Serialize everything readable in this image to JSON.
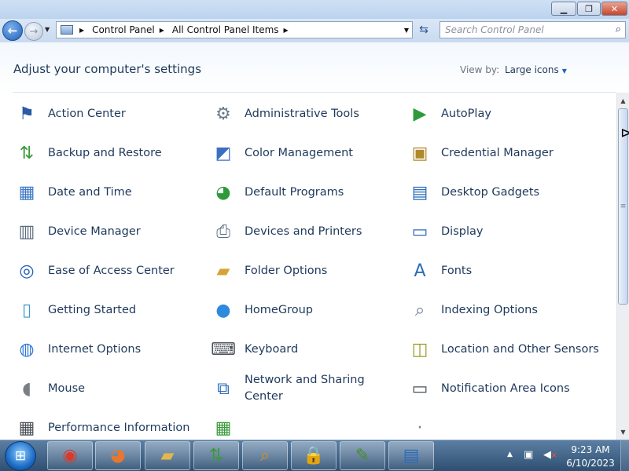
{
  "window": {
    "minimize": "▁",
    "maximize": "❐",
    "close": "✕"
  },
  "address": {
    "crumbs": [
      "Control Panel",
      "All Control Panel Items"
    ],
    "separator": "▶",
    "search_placeholder": "Search Control Panel"
  },
  "header": {
    "title": "Adjust your computer's settings",
    "view_by_label": "View by:",
    "view_by_value": "Large icons"
  },
  "items": [
    {
      "label": "Action Center",
      "icon": "flag-icon",
      "glyph": "⚑",
      "color": "#2a5aa8"
    },
    {
      "label": "Administrative Tools",
      "icon": "admin-tools-icon",
      "glyph": "⚙",
      "color": "#6a7a8c"
    },
    {
      "label": "AutoPlay",
      "icon": "autoplay-icon",
      "glyph": "▶",
      "color": "#2e9a3a"
    },
    {
      "label": "Backup and Restore",
      "icon": "backup-icon",
      "glyph": "⇅",
      "color": "#3a9a3a"
    },
    {
      "label": "Color Management",
      "icon": "color-management-icon",
      "glyph": "◩",
      "color": "#3c6fc4"
    },
    {
      "label": "Credential Manager",
      "icon": "credential-manager-icon",
      "glyph": "▣",
      "color": "#b08a2a"
    },
    {
      "label": "Date and Time",
      "icon": "calendar-clock-icon",
      "glyph": "▦",
      "color": "#3b78c7"
    },
    {
      "label": "Default Programs",
      "icon": "default-programs-icon",
      "glyph": "◕",
      "color": "#2e9a3a"
    },
    {
      "label": "Desktop Gadgets",
      "icon": "desktop-gadgets-icon",
      "glyph": "▤",
      "color": "#2b6cb8"
    },
    {
      "label": "Device Manager",
      "icon": "device-manager-icon",
      "glyph": "▥",
      "color": "#5b6b80"
    },
    {
      "label": "Devices and Printers",
      "icon": "printer-icon",
      "glyph": "⎙",
      "color": "#5b6b80"
    },
    {
      "label": "Display",
      "icon": "monitor-icon",
      "glyph": "▭",
      "color": "#2b6cb8"
    },
    {
      "label": "Ease of Access Center",
      "icon": "ease-of-access-icon",
      "glyph": "◎",
      "color": "#1f5fb8"
    },
    {
      "label": "Folder Options",
      "icon": "folder-options-icon",
      "glyph": "▰",
      "color": "#d4a534"
    },
    {
      "label": "Fonts",
      "icon": "fonts-icon",
      "glyph": "A",
      "color": "#2b6cb8"
    },
    {
      "label": "Getting Started",
      "icon": "getting-started-icon",
      "glyph": "▯",
      "color": "#3a9ad0"
    },
    {
      "label": "HomeGroup",
      "icon": "homegroup-icon",
      "glyph": "●",
      "color": "#2e8adc"
    },
    {
      "label": "Indexing Options",
      "icon": "indexing-icon",
      "glyph": "⌕",
      "color": "#6a7a8c"
    },
    {
      "label": "Internet Options",
      "icon": "internet-options-icon",
      "glyph": "◍",
      "color": "#2e7ad6"
    },
    {
      "label": "Keyboard",
      "icon": "keyboard-icon",
      "glyph": "⌨",
      "color": "#4a4f57"
    },
    {
      "label": "Location and Other Sensors",
      "icon": "sensors-icon",
      "glyph": "◫",
      "color": "#9a9a2a"
    },
    {
      "label": "Mouse",
      "icon": "mouse-icon",
      "glyph": "◖",
      "color": "#7a7f86"
    },
    {
      "label": "Network and Sharing Center",
      "icon": "network-icon",
      "glyph": "⧉",
      "color": "#2b6cb8"
    },
    {
      "label": "Notification Area Icons",
      "icon": "notification-area-icon",
      "glyph": "▭",
      "color": "#4a4f57"
    },
    {
      "label": "Performance Information",
      "icon": "performance-icon",
      "glyph": "▦",
      "color": "#4a4f57"
    },
    {
      "label": "",
      "icon": "personalization-icon",
      "glyph": "▦",
      "color": "#3a9a3a"
    },
    {
      "label": "",
      "icon": "phone-modem-icon",
      "glyph": "·",
      "color": "#7a7f86"
    }
  ],
  "taskbar": {
    "apps": [
      {
        "name": "chrome-icon",
        "glyph": "◉",
        "color": "#d93a2b"
      },
      {
        "name": "firefox-icon",
        "glyph": "◕",
        "color": "#e8772e"
      },
      {
        "name": "file-explorer-icon",
        "glyph": "▰",
        "color": "#e0b84a"
      },
      {
        "name": "network-drive-icon",
        "glyph": "⇅",
        "color": "#3a9a3a"
      },
      {
        "name": "search-tool-icon",
        "glyph": "⌕",
        "color": "#e09020"
      },
      {
        "name": "lock-icon",
        "glyph": "🔒",
        "color": "#1e2a4a"
      },
      {
        "name": "notepad-icon",
        "glyph": "✎",
        "color": "#4a8a2a"
      },
      {
        "name": "control-panel-icon",
        "glyph": "▤",
        "color": "#2b6cb8"
      }
    ],
    "time": "9:23 AM",
    "date": "6/10/2023"
  }
}
